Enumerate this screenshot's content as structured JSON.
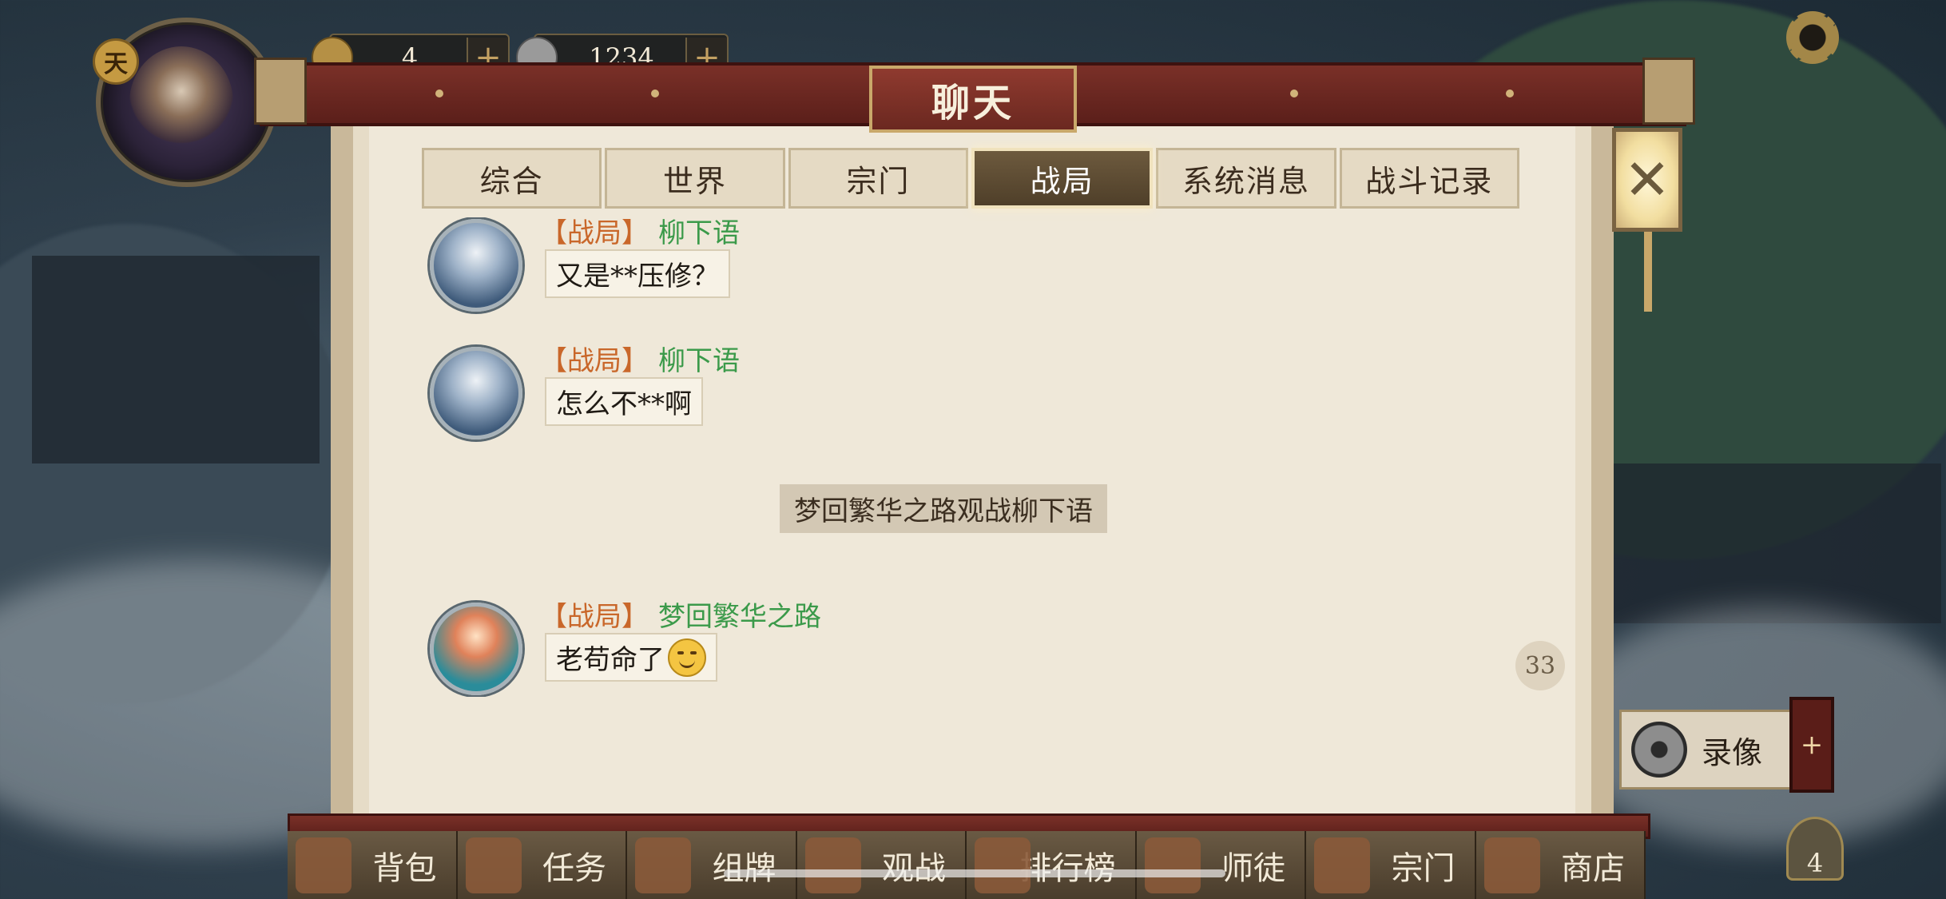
{
  "hud": {
    "rank_badge": "天",
    "gold": "4",
    "coins": "1234"
  },
  "panel": {
    "title": "聊天",
    "tabs": [
      {
        "label": "综合",
        "active": false
      },
      {
        "label": "世界",
        "active": false
      },
      {
        "label": "宗门",
        "active": false
      },
      {
        "label": "战局",
        "active": true
      },
      {
        "label": "系统消息",
        "active": false
      },
      {
        "label": "战斗记录",
        "active": false
      }
    ],
    "messages": [
      {
        "channel": "【战局】",
        "name": "柳下语",
        "text": "又是**压修？"
      },
      {
        "channel": "【战局】",
        "name": "柳下语",
        "text": "怎么不**啊"
      },
      {
        "channel": "【战局】",
        "name": "梦回繁华之路",
        "text": "老苟命了"
      }
    ],
    "system_note": "梦回繁华之路观战柳下语",
    "unread_count": "33",
    "close_icon": "✕"
  },
  "side": {
    "replay_label": "录像",
    "power_symbol": "+",
    "chest_count": "4"
  },
  "bottom_nav": [
    {
      "label": "背包",
      "icon": "backpack-icon"
    },
    {
      "label": "任务",
      "icon": "quest-icon"
    },
    {
      "label": "组牌",
      "icon": "deck-icon"
    },
    {
      "label": "观战",
      "icon": "spectate-icon"
    },
    {
      "label": "排行榜",
      "icon": "leaderboard-icon"
    },
    {
      "label": "师徒",
      "icon": "mentor-icon"
    },
    {
      "label": "宗门",
      "icon": "sect-icon"
    },
    {
      "label": "商店",
      "icon": "shop-icon"
    }
  ],
  "colors": {
    "channel": "#c9672a",
    "username": "#3b9a4a",
    "title_bar": "#7a3028"
  }
}
